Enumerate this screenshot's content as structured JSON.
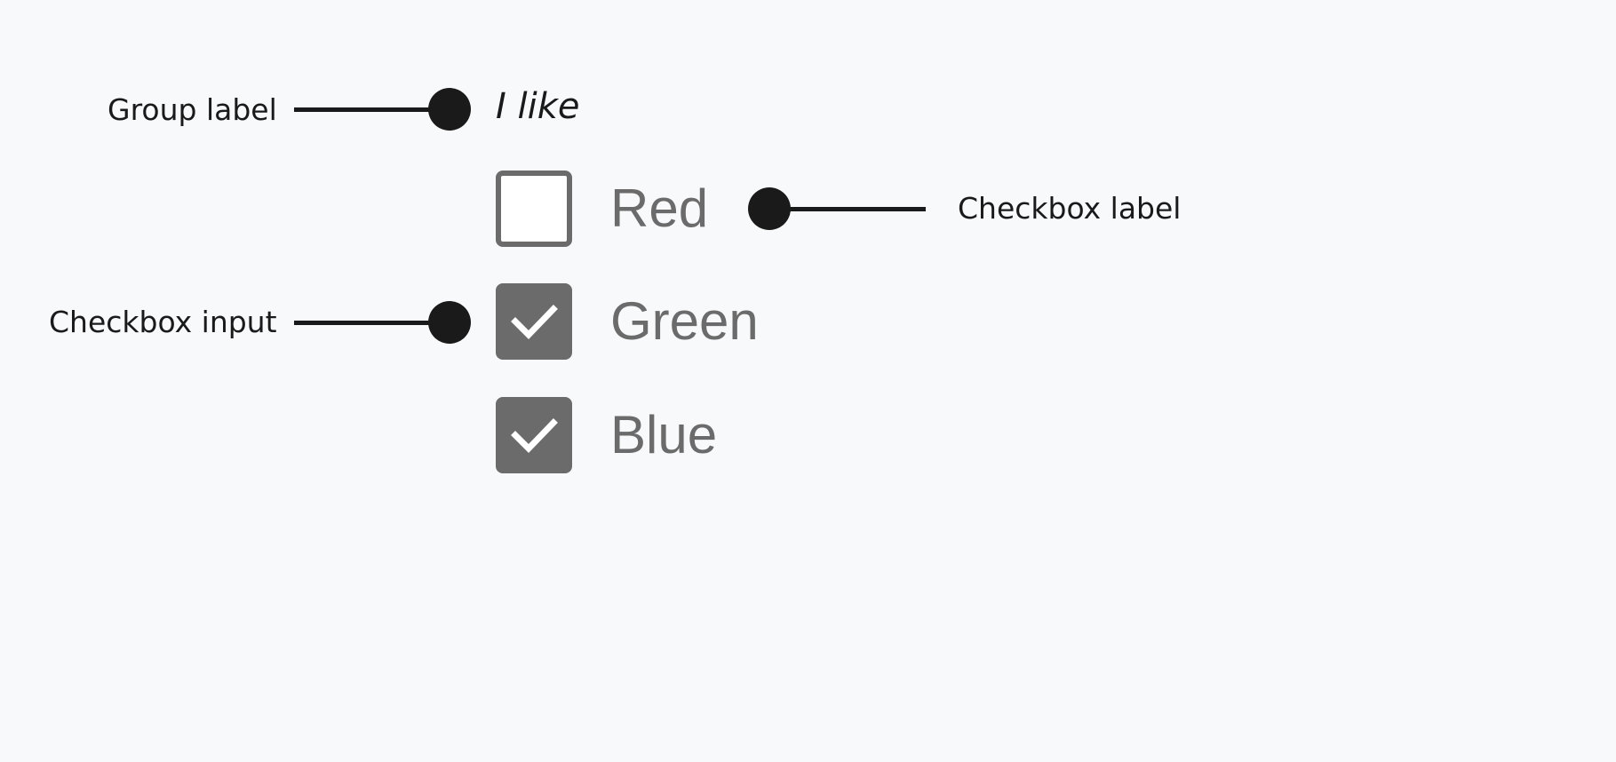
{
  "annotations": {
    "group_label": "Group label",
    "checkbox_label": "Checkbox label",
    "checkbox_input": "Checkbox input"
  },
  "form": {
    "group_label": "I like",
    "options": [
      {
        "label": "Red",
        "checked": false
      },
      {
        "label": "Green",
        "checked": true
      },
      {
        "label": "Blue",
        "checked": true
      }
    ]
  },
  "colors": {
    "background": "#f8f9fb",
    "annotation": "#1a1a1a",
    "checkbox": "#6b6b6b",
    "checkmark": "#ffffff"
  },
  "icons": {
    "connector_dot": "dot-icon",
    "checkmark": "checkmark-icon"
  }
}
